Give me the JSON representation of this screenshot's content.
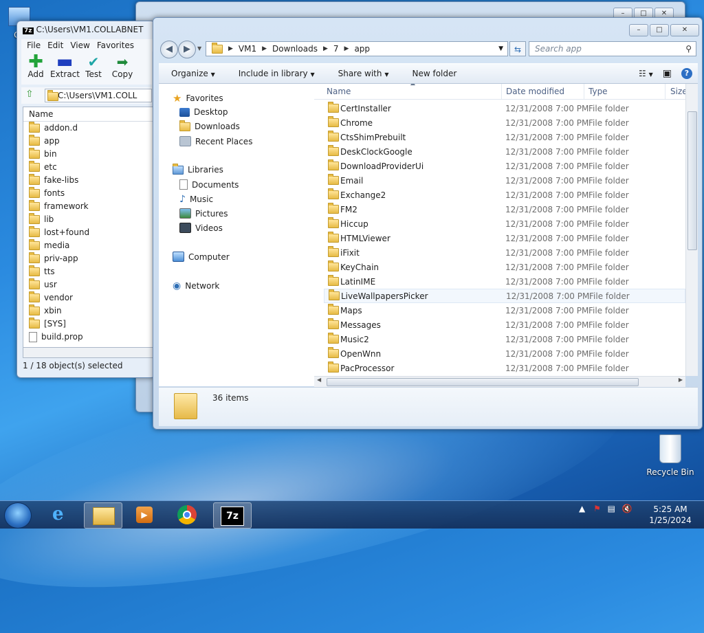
{
  "desktop": {
    "icons": [
      {
        "label": "Co"
      },
      {
        "label": "Recycle Bin"
      }
    ]
  },
  "sevenzip": {
    "title": "C:\\Users\\VM1.COLLABNET",
    "menu": [
      "File",
      "Edit",
      "View",
      "Favorites"
    ],
    "toolbar": [
      {
        "label": "Add",
        "icon": "plus-icon",
        "color": "#22a33a"
      },
      {
        "label": "Extract",
        "icon": "minus-icon",
        "color": "#1f3fbf"
      },
      {
        "label": "Test",
        "icon": "check-icon",
        "color": "#1fa6a6"
      },
      {
        "label": "Copy",
        "icon": "arrow-right-icon",
        "color": "#1f8a3a"
      }
    ],
    "address": "C:\\Users\\VM1.COLL",
    "column_name": "Name",
    "items": [
      "addon.d",
      "app",
      "bin",
      "etc",
      "fake-libs",
      "fonts",
      "framework",
      "lib",
      "lost+found",
      "media",
      "priv-app",
      "tts",
      "usr",
      "vendor",
      "xbin",
      "[SYS]",
      "build.prop"
    ],
    "status": "1 / 18 object(s) selected"
  },
  "explorer": {
    "breadcrumb": [
      "VM1",
      "Downloads",
      "7",
      "app"
    ],
    "search_placeholder": "Search app",
    "commands": {
      "organize": "Organize",
      "include": "Include in library",
      "share": "Share with",
      "newfolder": "New folder"
    },
    "nav": {
      "favorites": "Favorites",
      "desktop": "Desktop",
      "downloads": "Downloads",
      "recent": "Recent Places",
      "libraries": "Libraries",
      "documents": "Documents",
      "music": "Music",
      "pictures": "Pictures",
      "videos": "Videos",
      "computer": "Computer",
      "network": "Network"
    },
    "columns": {
      "name": "Name",
      "date": "Date modified",
      "type": "Type",
      "size": "Size"
    },
    "date": "12/31/2008 7:00 PM",
    "type": "File folder",
    "files": [
      "CertInstaller",
      "Chrome",
      "CtsShimPrebuilt",
      "DeskClockGoogle",
      "DownloadProviderUi",
      "Email",
      "Exchange2",
      "FM2",
      "Hiccup",
      "HTMLViewer",
      "iFixit",
      "KeyChain",
      "LatinIME",
      "LiveWallpapersPicker",
      "Maps",
      "Messages",
      "Music2",
      "OpenWnn",
      "PacProcessor"
    ],
    "hover_index": 13,
    "item_count": "36 items"
  },
  "taskbar": {
    "time": "5:25 AM",
    "date": "1/25/2024"
  }
}
